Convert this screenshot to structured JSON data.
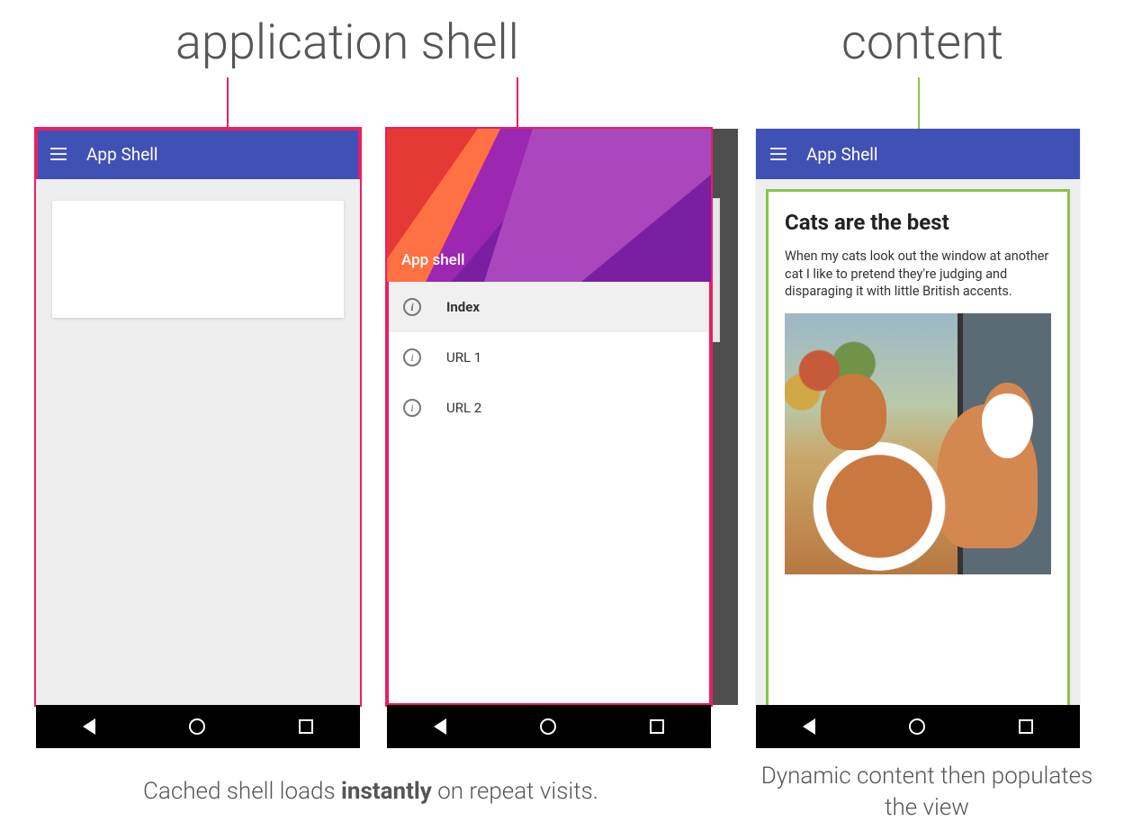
{
  "labels": {
    "shell_heading": "application shell",
    "content_heading": "content"
  },
  "appbar": {
    "title": "App Shell"
  },
  "drawer": {
    "header_title": "App shell",
    "items": [
      {
        "label": "Index",
        "selected": true
      },
      {
        "label": "URL 1",
        "selected": false
      },
      {
        "label": "URL 2",
        "selected": false
      }
    ]
  },
  "content": {
    "title": "Cats are the best",
    "body": "When my cats look out the window at another cat I like to pretend they're judging and disparaging it with little British accents."
  },
  "captions": {
    "shell_pre": "Cached shell loads ",
    "shell_bold": "instantly",
    "shell_post": " on repeat visits.",
    "content": "Dynamic content then populates the view"
  },
  "colors": {
    "pink": "#e91e63",
    "green": "#8bc34a",
    "appbar": "#3f51b5"
  }
}
